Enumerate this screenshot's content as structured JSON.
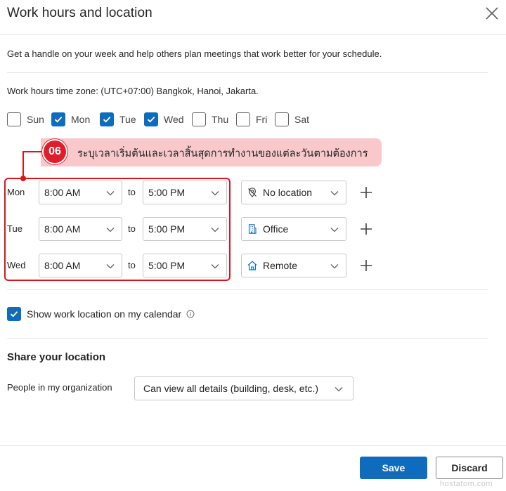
{
  "header": {
    "title": "Work hours and location"
  },
  "intro": "Get a handle on your week and help others plan meetings that work better for your schedule.",
  "timezone_text": "Work hours time zone: (UTC+07:00) Bangkok, Hanoi, Jakarta.",
  "days": [
    {
      "label": "Sun",
      "checked": false
    },
    {
      "label": "Mon",
      "checked": true
    },
    {
      "label": "Tue",
      "checked": true
    },
    {
      "label": "Wed",
      "checked": true
    },
    {
      "label": "Thu",
      "checked": false
    },
    {
      "label": "Fri",
      "checked": false
    },
    {
      "label": "Sat",
      "checked": false
    }
  ],
  "annotation": {
    "step": "06",
    "text": "ระบุเวลาเริ่มต้นและเวลาสิ้นสุดการทำงานของแต่ละวันตามต้องการ"
  },
  "schedule": {
    "to_label": "to",
    "rows": [
      {
        "day": "Mon",
        "start": "8:00 AM",
        "end": "5:00 PM",
        "location": "No location",
        "location_icon": "no-location-icon"
      },
      {
        "day": "Tue",
        "start": "8:00 AM",
        "end": "5:00 PM",
        "location": "Office",
        "location_icon": "building-icon"
      },
      {
        "day": "Wed",
        "start": "8:00 AM",
        "end": "5:00 PM",
        "location": "Remote",
        "location_icon": "home-icon"
      }
    ]
  },
  "show_location": {
    "label": "Show work location on my calendar",
    "checked": true
  },
  "share": {
    "heading": "Share your location",
    "people_label": "People in my organization",
    "selected": "Can view all details (building, desk, etc.)"
  },
  "buttons": {
    "save": "Save",
    "discard": "Discard"
  },
  "watermark": "hostatom.com",
  "colors": {
    "accent": "#0f6cbd",
    "annotation_red": "#d9161e",
    "annotation_bg": "#f9c8cb"
  }
}
